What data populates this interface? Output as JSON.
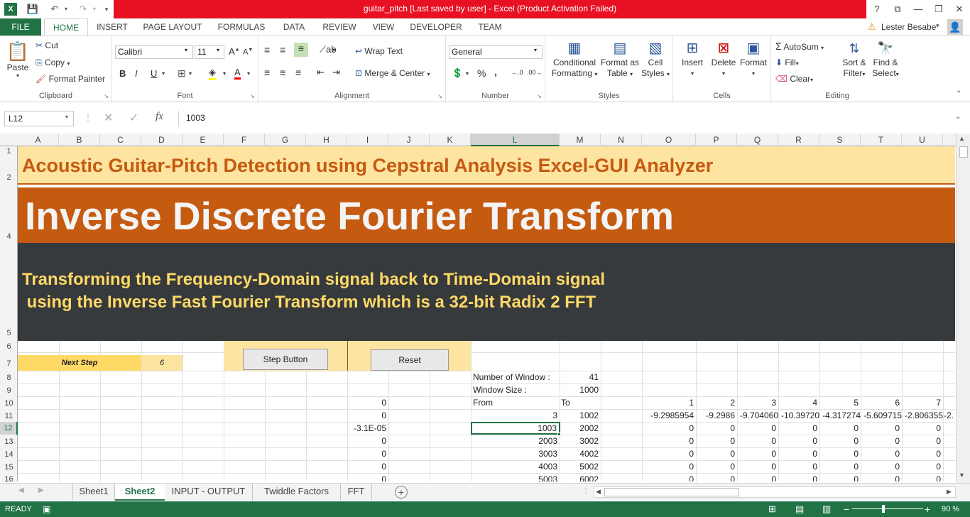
{
  "window": {
    "title": "guitar_pitch [Last saved by user] -  Excel (Product Activation Failed)",
    "help": "?",
    "restore": "⧉",
    "minimize": "—",
    "maximize": "❐",
    "close": "✕"
  },
  "ribbon_tabs": [
    "FILE",
    "HOME",
    "INSERT",
    "PAGE LAYOUT",
    "FORMULAS",
    "DATA",
    "REVIEW",
    "VIEW",
    "DEVELOPER",
    "TEAM"
  ],
  "user": "Lester Besabe",
  "clipboard": {
    "paste": "Paste",
    "cut": "Cut",
    "copy": "Copy",
    "format_painter": "Format Painter",
    "label": "Clipboard"
  },
  "font": {
    "name": "Calibri",
    "size": "11",
    "bold": "B",
    "italic": "I",
    "underline": "U",
    "label": "Font"
  },
  "alignment": {
    "wrap": "Wrap Text",
    "merge": "Merge & Center",
    "label": "Alignment"
  },
  "number": {
    "format": "General",
    "percent": "%",
    "comma": ",",
    "label": "Number"
  },
  "styles": {
    "cond1": "Conditional",
    "cond2": "Formatting",
    "fmt1": "Format as",
    "fmt2": "Table",
    "cell1": "Cell",
    "cell2": "Styles",
    "label": "Styles"
  },
  "cells": {
    "insert": "Insert",
    "delete": "Delete",
    "format": "Format",
    "label": "Cells"
  },
  "editing": {
    "autosum": "AutoSum",
    "fill": "Fill",
    "clear": "Clear",
    "sort1": "Sort &",
    "sort2": "Filter",
    "find1": "Find &",
    "find2": "Select",
    "label": "Editing"
  },
  "formula_bar": {
    "namebox": "L12",
    "fx": "fx",
    "value": "1003"
  },
  "columns": [
    "A",
    "B",
    "C",
    "D",
    "E",
    "F",
    "G",
    "H",
    "I",
    "J",
    "K",
    "L",
    "M",
    "N",
    "O",
    "P",
    "Q",
    "R",
    "S",
    "T",
    "U"
  ],
  "rows": [
    "1",
    "2",
    "4",
    "5",
    "6",
    "7",
    "8",
    "9",
    "10",
    "11",
    "12",
    "13",
    "14",
    "15",
    "16"
  ],
  "sheet": {
    "title1": "Acoustic Guitar-Pitch Detection using Cepstral Analysis Excel-GUI Analyzer",
    "title2": "Inverse Discrete Fourier Transform",
    "subtitle1": "Transforming the Frequency-Domain signal back to Time-Domain signal",
    "subtitle2": " using the Inverse Fast Fourier Transform which is a 32-bit Radix 2 FFT",
    "next_step_label": "Next Step",
    "next_step_value": "6",
    "step_button": "Step Button",
    "reset_button": "Reset",
    "num_window_label": "Number of Window :",
    "num_window_value": "41",
    "window_size_label": "Window Size :",
    "window_size_value": "1000",
    "from_label": "From",
    "to_label": "To",
    "col_headers": [
      "1",
      "2",
      "3",
      "4",
      "5",
      "6",
      "7"
    ],
    "rows": [
      {
        "i": "0",
        "from": "3",
        "to": "1002",
        "vals": [
          "-9.2985954",
          "-9.2986",
          "-9.704060",
          "-10.39720",
          "-4.317274",
          "-5.609715",
          "-2.806355",
          "-2."
        ]
      },
      {
        "i": "-3.1E-05",
        "from": "1003",
        "to": "2002",
        "vals": [
          "0",
          "0",
          "0",
          "0",
          "0",
          "0",
          "0"
        ]
      },
      {
        "i": "0",
        "from": "2003",
        "to": "3002",
        "vals": [
          "0",
          "0",
          "0",
          "0",
          "0",
          "0",
          "0"
        ]
      },
      {
        "i": "0",
        "from": "3003",
        "to": "4002",
        "vals": [
          "0",
          "0",
          "0",
          "0",
          "0",
          "0",
          "0"
        ]
      },
      {
        "i": "0",
        "from": "4003",
        "to": "5002",
        "vals": [
          "0",
          "0",
          "0",
          "0",
          "0",
          "0",
          "0"
        ]
      },
      {
        "i": "0",
        "from": "5003",
        "to": "6002",
        "vals": [
          "0",
          "0",
          "0",
          "0",
          "0",
          "0",
          "0"
        ]
      }
    ],
    "i10": "0"
  },
  "sheet_tabs": [
    "Sheet1",
    "Sheet2",
    "INPUT - OUTPUT",
    "Twiddle Factors",
    "FFT"
  ],
  "status": {
    "ready": "READY",
    "zoom": "90 %"
  },
  "colors": {
    "excel_green": "#217346",
    "title_band": "#fde4a0",
    "title_text": "#c55a11",
    "orange_band": "#c55a11",
    "dark_band": "#373a3c",
    "yellow_text": "#ffd966",
    "next_step_bg": "#ffd966"
  }
}
